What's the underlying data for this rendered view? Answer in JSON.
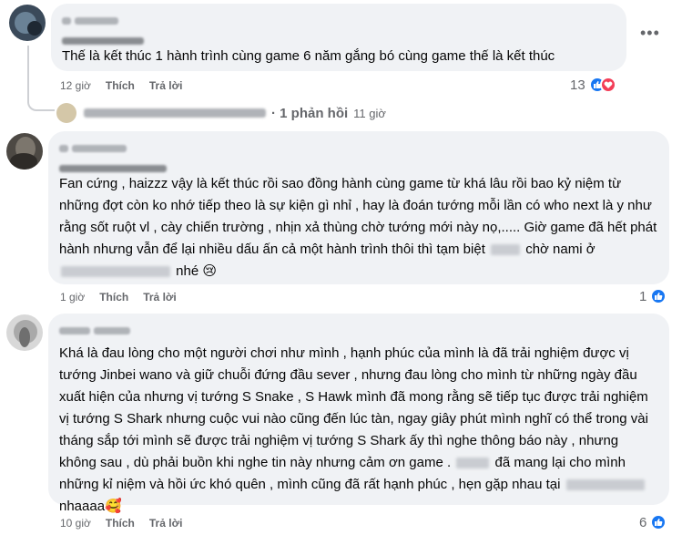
{
  "comments": [
    {
      "text": "Thế là kết thúc 1 hành trình cùng game 6 năm gắng bó cùng game thế là kết thúc",
      "time": "12 giờ",
      "like_label": "Thích",
      "reply_label": "Trả lời",
      "reaction_count": "13",
      "reactions": [
        "like-icon",
        "love-icon"
      ]
    },
    {
      "text_parts": [
        "Fan cứng , haizzz vậy là kết thúc rồi sao đồng hành cùng game từ khá lâu rồi bao kỷ niệm từ những đợt còn ko nhớ tiếp theo là sự kiện gì nhỉ , hay là đoán tướng mỗi lần có who next là y như rằng sốt ruột vl , cày chiến trường , nhịn xả thùng chờ tướng mới này nọ,..... Giờ game đã hết phát hành nhưng vẫn để lại nhiều dấu ấn cả một hành trình thôi thì tạm biệt ",
        " chờ nami ở ",
        " nhé 😢"
      ],
      "time": "1 giờ",
      "like_label": "Thích",
      "reply_label": "Trả lời",
      "reaction_count": "1",
      "reactions": [
        "like-icon"
      ]
    },
    {
      "text_parts": [
        "Khá là đau lòng cho một người chơi như mình , hạnh phúc của mình là đã trải nghiệm được vị tướng Jinbei wano và giữ chuỗi đứng đầu sever , nhưng đau lòng cho mình từ những ngày đầu xuất hiện của nhưng vị tướng S Snake , S Hawk mình đã mong rằng sẽ tiếp tục được trải nghiệm vị tướng S Shark nhưng cuộc vui nào cũng đến lúc tàn, ngay giây phút mình nghĩ có thể trong vài tháng sắp tới mình sẽ được trải nghiệm vị tướng S Shark ấy thì nghe thông báo này , nhưng không sau , dù phải buồn khi nghe tin này nhưng cảm ơn game . ",
        " đã mang lại cho mình những kỉ niệm và hồi ức khó quên , mình cũng đã rất hạnh phúc , hẹn gặp nhau tại ",
        " nhaaaa🥰"
      ],
      "time": "10 giờ",
      "like_label": "Thích",
      "reply_label": "Trả lời",
      "reaction_count": "6",
      "reactions": [
        "like-icon"
      ]
    }
  ],
  "reply_summary": {
    "count_label": "1 phản hồi",
    "time": "11 giờ"
  },
  "more_icon": "more-horizontal-icon",
  "colors": {
    "bubble": "#f0f2f5",
    "meta": "#65676b",
    "like": "#1877f2",
    "love": "#f33e58"
  }
}
